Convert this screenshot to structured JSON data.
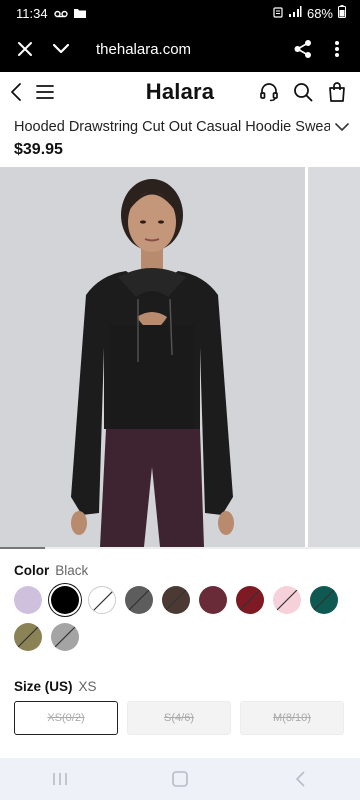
{
  "status_bar": {
    "time": "11:34",
    "battery": "68%"
  },
  "browser": {
    "url": "thehalara.com"
  },
  "site": {
    "logo": "Halara"
  },
  "product": {
    "title": "Hooded Drawstring Cut Out Casual Hoodie Sweatshirt",
    "price": "$39.95"
  },
  "color": {
    "label": "Color",
    "selected_value": "Black",
    "swatches": [
      {
        "name": "lilac",
        "hex": "#cfc0dd",
        "sold_out": false,
        "selected": false
      },
      {
        "name": "black",
        "hex": "#000000",
        "sold_out": false,
        "selected": true
      },
      {
        "name": "white",
        "hex": "#ffffff",
        "sold_out": true,
        "selected": false
      },
      {
        "name": "dark-gray",
        "hex": "#5d5d5d",
        "sold_out": true,
        "selected": false
      },
      {
        "name": "brown",
        "hex": "#4a3a33",
        "sold_out": true,
        "selected": false
      },
      {
        "name": "burgundy",
        "hex": "#6a2b38",
        "sold_out": false,
        "selected": false
      },
      {
        "name": "red",
        "hex": "#7e1a24",
        "sold_out": true,
        "selected": false
      },
      {
        "name": "light-pink",
        "hex": "#f7d1da",
        "sold_out": true,
        "selected": false
      },
      {
        "name": "teal",
        "hex": "#0e5a52",
        "sold_out": true,
        "selected": false
      },
      {
        "name": "olive",
        "hex": "#8b8356",
        "sold_out": true,
        "selected": false
      },
      {
        "name": "light-gray",
        "hex": "#a4a4a4",
        "sold_out": true,
        "selected": false
      }
    ]
  },
  "size": {
    "label": "Size (US)",
    "selected_value": "XS",
    "options": [
      {
        "label": "XS(0/2)",
        "selected": true
      },
      {
        "label": "S(4/6)",
        "selected": false
      },
      {
        "label": "M(8/10)",
        "selected": false
      }
    ]
  },
  "icons": {
    "close": "close-icon",
    "dropdown": "chevron-down-icon",
    "share": "share-icon",
    "more": "more-vertical-icon",
    "back": "chevron-left-icon",
    "menu": "hamburger-menu-icon",
    "support": "headset-icon",
    "search": "search-icon",
    "bag": "shopping-bag-icon"
  }
}
